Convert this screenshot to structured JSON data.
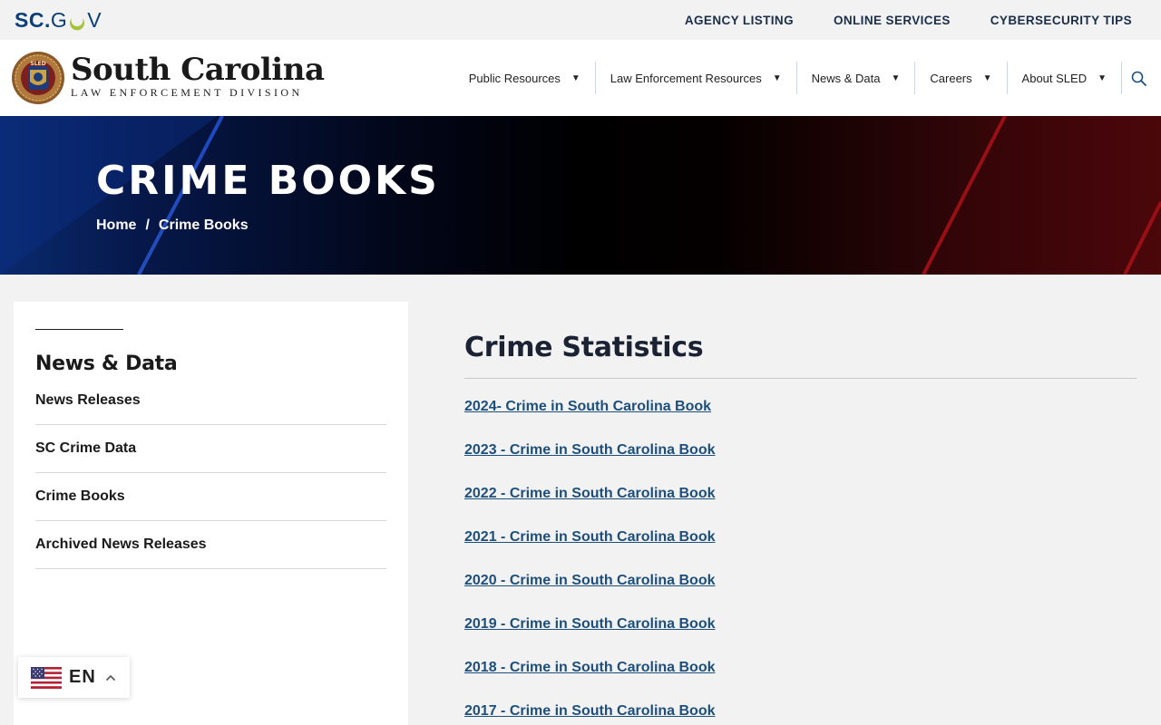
{
  "topbar": {
    "logo": {
      "sc": "SC",
      "dot": ".",
      "g": "G",
      "v": "V"
    },
    "links": [
      "AGENCY LISTING",
      "ONLINE SERVICES",
      "CYBERSECURITY TIPS"
    ]
  },
  "header": {
    "seal_text": "SLED",
    "title": "South Carolina",
    "subtitle": "LAW ENFORCEMENT DIVISION",
    "nav": [
      {
        "label": "Public Resources"
      },
      {
        "label": "Law Enforcement Resources"
      },
      {
        "label": "News & Data"
      },
      {
        "label": "Careers"
      },
      {
        "label": "About SLED"
      }
    ],
    "caret_glyph": "▼",
    "search_icon": "search-icon"
  },
  "hero": {
    "title": "CRIME BOOKS",
    "breadcrumb": {
      "home": "Home",
      "separator": "/",
      "current": "Crime Books"
    }
  },
  "sidebar": {
    "title": "News & Data",
    "items": [
      {
        "label": "News Releases"
      },
      {
        "label": "SC Crime Data"
      },
      {
        "label": "Crime Books"
      },
      {
        "label": "Archived News Releases"
      }
    ]
  },
  "language": {
    "code": "EN",
    "flag_icon": "us-flag-icon"
  },
  "main": {
    "heading": "Crime Statistics",
    "books": [
      {
        "label": "2024- Crime in South Carolina Book "
      },
      {
        "label": "2023 - Crime in South Carolina Book"
      },
      {
        "label": "2022 - Crime in South Carolina Book"
      },
      {
        "label": "2021 - Crime in South Carolina Book"
      },
      {
        "label": "2020 - Crime in South Carolina Book"
      },
      {
        "label": "2019 - Crime in South Carolina Book"
      },
      {
        "label": "2018 - Crime in South Carolina Book"
      },
      {
        "label": "2017 - Crime in South Carolina Book"
      }
    ]
  },
  "colors": {
    "brand_navy": "#0b3e78",
    "link_blue": "#1d4f7c",
    "hero_blue": "#0a2a6e",
    "hero_red": "#55080c",
    "moon_green": "#a6c43a"
  }
}
